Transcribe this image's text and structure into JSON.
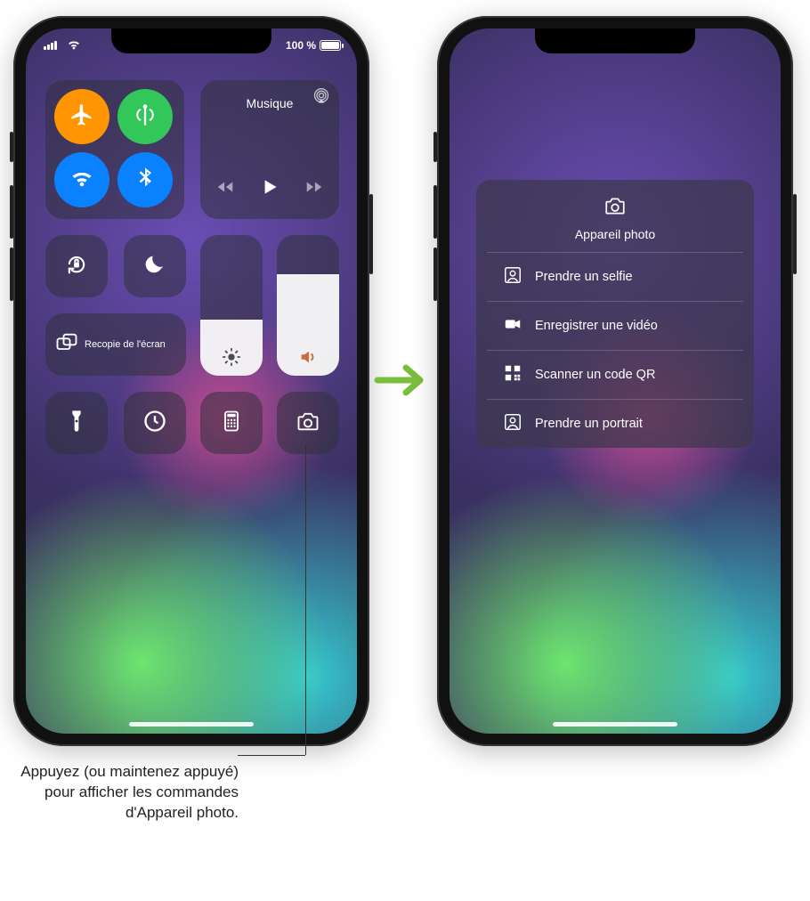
{
  "status": {
    "battery_text": "100 %"
  },
  "control_center": {
    "media_title": "Musique",
    "screen_mirror_label": "Recopie de l'écran",
    "brightness_pct": 40,
    "volume_pct": 72
  },
  "callout": {
    "text": "Appuyez (ou maintenez appuyé) pour afficher les commandes d'Appareil photo."
  },
  "camera_menu": {
    "title": "Appareil photo",
    "items": [
      "Prendre un selfie",
      "Enregistrer une vidéo",
      "Scanner un code QR",
      "Prendre un portrait"
    ]
  }
}
